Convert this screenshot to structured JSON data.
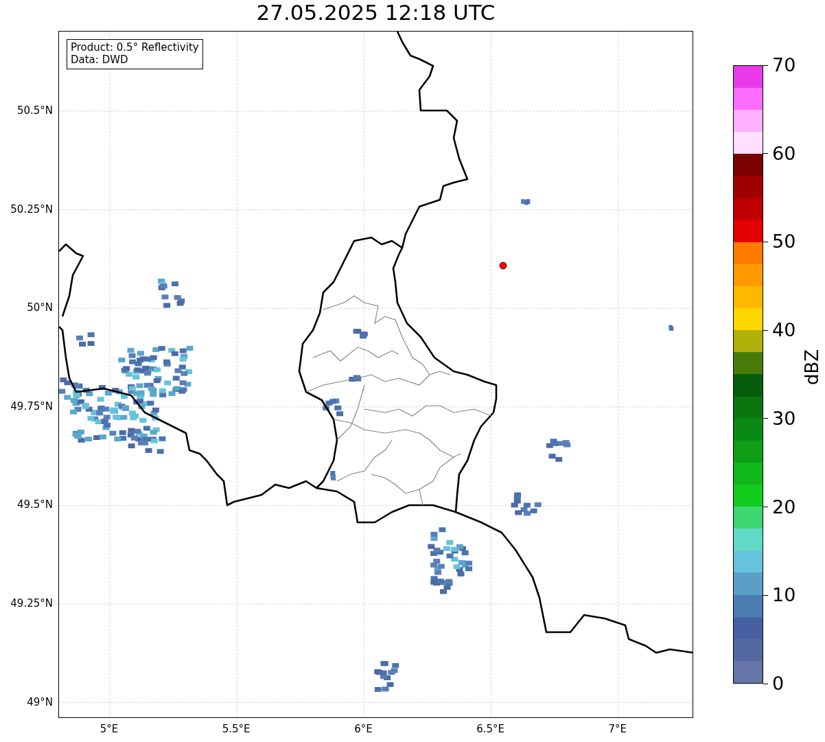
{
  "title": "27.05.2025 12:18 UTC",
  "info_box": {
    "lines": [
      "Product: 0.5° Reflectivity",
      "Data: DWD"
    ]
  },
  "map": {
    "y_ticks": [
      "50.5°N",
      "50.25°N",
      "50°N",
      "49.75°N",
      "49.5°N",
      "49.25°N",
      "49°N"
    ],
    "x_ticks": [
      "5°E",
      "5.5°E",
      "6°E",
      "6.5°E",
      "7°E"
    ]
  },
  "colorbar": {
    "label": "dBZ",
    "ticks": [
      "70",
      "60",
      "50",
      "40",
      "30",
      "20",
      "10",
      "0"
    ],
    "segments": [
      {
        "color": "#6675a8"
      },
      {
        "color": "#5468a0"
      },
      {
        "color": "#4660a4"
      },
      {
        "color": "#4b7db3"
      },
      {
        "color": "#5a9fc8"
      },
      {
        "color": "#66c3dc"
      },
      {
        "color": "#62d9c4"
      },
      {
        "color": "#3dd771"
      },
      {
        "color": "#12cc1e"
      },
      {
        "color": "#10b81a"
      },
      {
        "color": "#0f9e16"
      },
      {
        "color": "#0a8a14"
      },
      {
        "color": "#0b7610"
      },
      {
        "color": "#075c0c"
      },
      {
        "color": "#487b0a"
      },
      {
        "color": "#b0b00a"
      },
      {
        "color": "#ffd700"
      },
      {
        "color": "#ffb800"
      },
      {
        "color": "#ff9b00"
      },
      {
        "color": "#ff7b00"
      },
      {
        "color": "#e40000"
      },
      {
        "color": "#c00000"
      },
      {
        "color": "#a00000"
      },
      {
        "color": "#7a0000"
      },
      {
        "color": "#ffdfff"
      },
      {
        "color": "#ffb0ff"
      },
      {
        "color": "#ff6cff"
      },
      {
        "color": "#e83aeb"
      }
    ]
  }
}
